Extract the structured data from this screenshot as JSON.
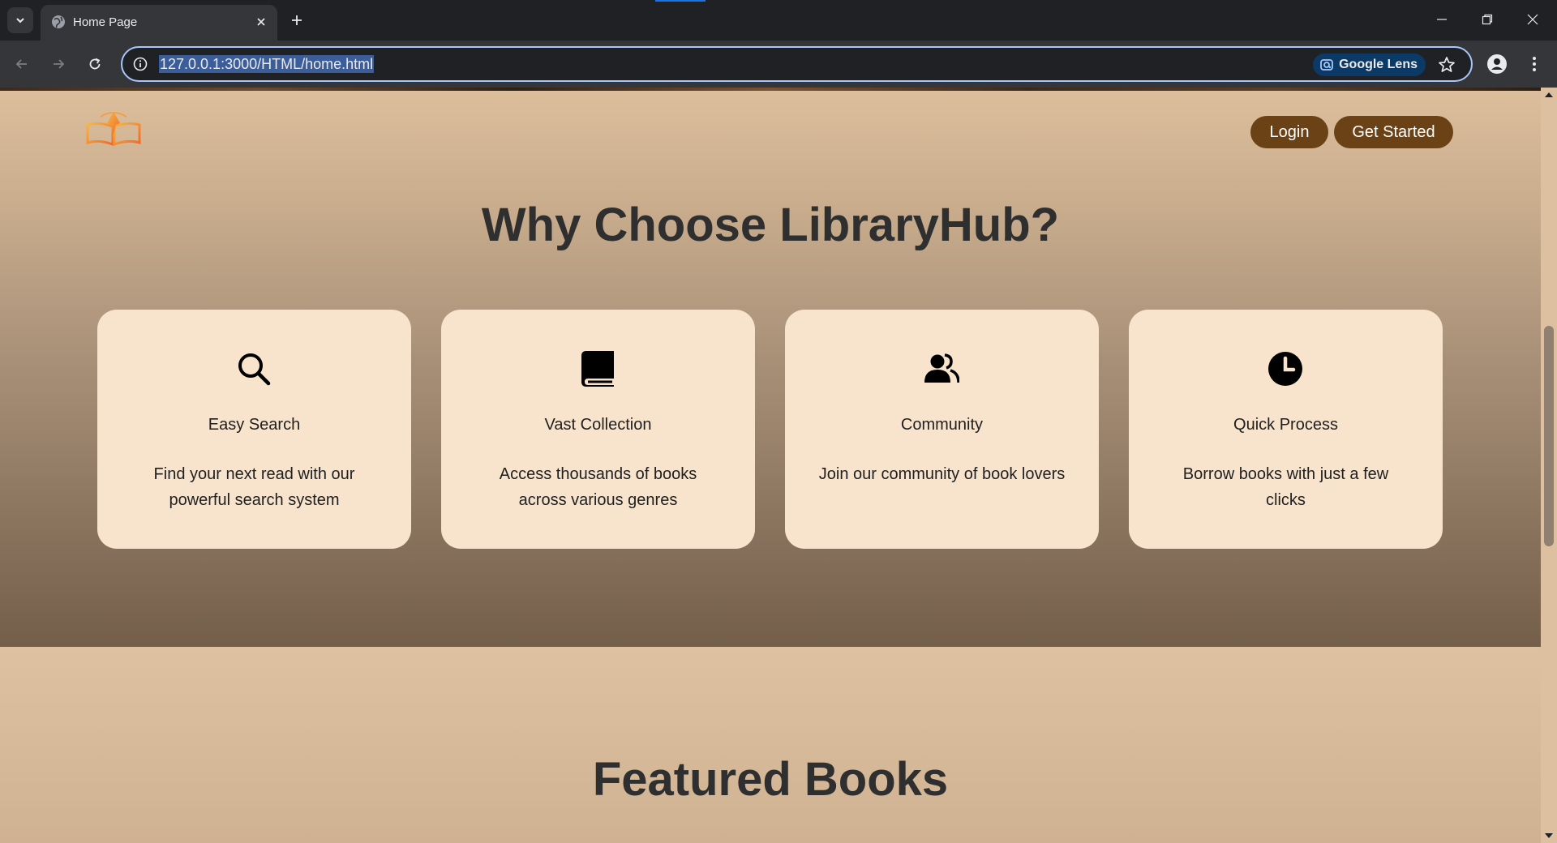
{
  "browser": {
    "tab_title": "Home Page",
    "url_full": "127.0.0.1:3000/HTML/home.html",
    "lens_label": "Google Lens"
  },
  "header": {
    "login_label": "Login",
    "get_started_label": "Get Started"
  },
  "why_section": {
    "title": "Why Choose LibraryHub?",
    "features": [
      {
        "icon": "search-icon",
        "title": "Easy Search",
        "description": "Find your next read with our powerful search system"
      },
      {
        "icon": "book-icon",
        "title": "Vast Collection",
        "description": "Access thousands of books across various genres"
      },
      {
        "icon": "users-icon",
        "title": "Community",
        "description": "Join our community of book lovers"
      },
      {
        "icon": "clock-icon",
        "title": "Quick Process",
        "description": "Borrow books with just a few clicks"
      }
    ]
  },
  "featured_section": {
    "title": "Featured Books"
  },
  "colors": {
    "button_brown": "#6b4216",
    "card_bg": "#f8e4cc",
    "heading": "#2f2f2f"
  }
}
